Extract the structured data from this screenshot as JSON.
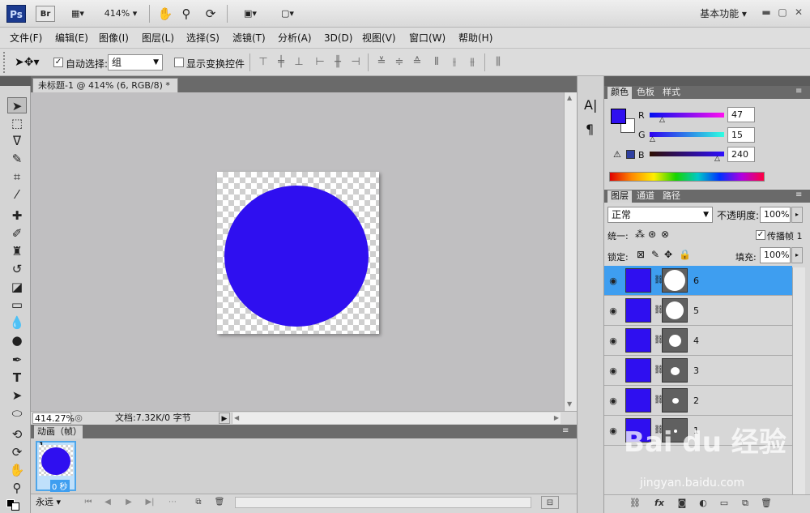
{
  "app": {
    "logo": "Ps",
    "bridge": "Br",
    "zoom": "414%",
    "workspace": "基本功能"
  },
  "window_controls": {
    "min": "▬",
    "max": "▢",
    "close": "✕"
  },
  "menu": [
    "文件(F)",
    "编辑(E)",
    "图像(I)",
    "图层(L)",
    "选择(S)",
    "滤镜(T)",
    "分析(A)",
    "3D(D)",
    "视图(V)",
    "窗口(W)",
    "帮助(H)"
  ],
  "options": {
    "auto_select_label": "自动选择:",
    "auto_select_value": "组",
    "show_transform_label": "显示变换控件"
  },
  "document": {
    "tab_title": "未标题-1 @ 414% (6, RGB/8) *",
    "status_zoom": "414.27%",
    "status_doc": "文档:7.32K/0 字节"
  },
  "animation": {
    "tab_label": "动画（帧）",
    "frame_number": "1",
    "frame_delay": "0 秒",
    "loop": "永远"
  },
  "color_panel": {
    "tabs": [
      "颜色",
      "色板",
      "样式"
    ],
    "r_label": "R",
    "g_label": "G",
    "b_label": "B",
    "r": "47",
    "g": "15",
    "b": "240",
    "fg_color": "#2f0ff0"
  },
  "layers_panel": {
    "tabs": [
      "图层",
      "通道",
      "路径"
    ],
    "blend_mode": "正常",
    "opacity_label": "不透明度:",
    "opacity": "100%",
    "unify_label": "统一:",
    "propagate_label": "传播帧 1",
    "lock_label": "锁定:",
    "fill_label": "填充:",
    "fill": "100%",
    "layers": [
      {
        "name": "6"
      },
      {
        "name": "5"
      },
      {
        "name": "4"
      },
      {
        "name": "3"
      },
      {
        "name": "2"
      },
      {
        "name": "1"
      }
    ]
  },
  "watermark": {
    "brand": "Bai du 经验",
    "url": "jingyan.baidu.com"
  }
}
